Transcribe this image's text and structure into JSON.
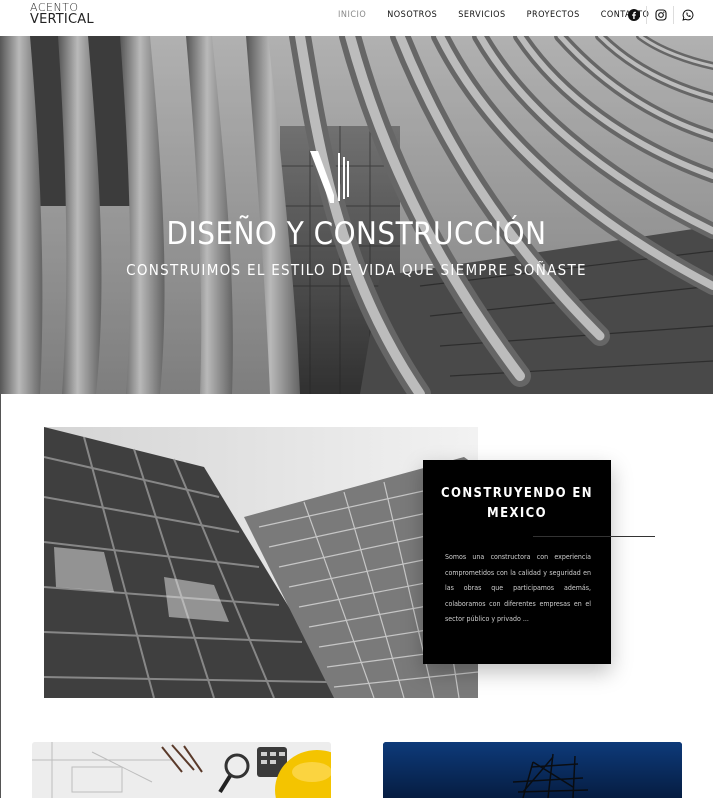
{
  "brand": {
    "logo_line1": "ACENTO",
    "logo_line2": "VERTICAL"
  },
  "nav": {
    "items": [
      {
        "label": "INICIO",
        "active": true
      },
      {
        "label": "NOSOTROS",
        "active": false
      },
      {
        "label": "SERVICIOS",
        "active": false
      },
      {
        "label": "PROYECTOS",
        "active": false
      },
      {
        "label": "CONTACTO",
        "active": false
      }
    ],
    "social": [
      {
        "icon": "facebook-icon"
      },
      {
        "icon": "instagram-icon"
      },
      {
        "icon": "whatsapp-icon"
      }
    ]
  },
  "hero": {
    "title": "DISEÑO Y CONSTRUCCIÓN",
    "subtitle": "CONSTRUIMOS EL ESTILO DE VIDA QUE SIEMPRE SOÑASTE"
  },
  "about": {
    "heading": "CONSTRUYENDO EN MEXICO",
    "text": "Somos una constructora con experiencia comprometidos con la calidad y seguridad en las obras que participamos además, colaboramos con diferentes empresas en el sector público y privado ..."
  },
  "colors": {
    "text": "#111111",
    "muted": "#888888",
    "card_bg": "#000000",
    "night_blue": "#0b2a5a"
  }
}
